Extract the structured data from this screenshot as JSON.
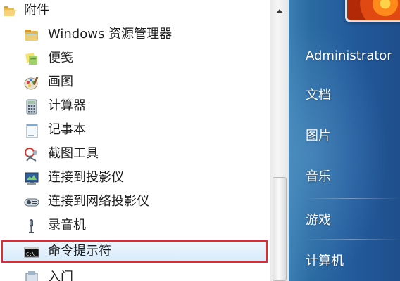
{
  "programs": {
    "folder_label": "附件",
    "items": [
      {
        "label": "Windows 资源管理器",
        "icon": "explorer-folder-icon"
      },
      {
        "label": "便笺",
        "icon": "sticky-notes-icon"
      },
      {
        "label": "画图",
        "icon": "paint-palette-icon"
      },
      {
        "label": "计算器",
        "icon": "calculator-icon"
      },
      {
        "label": "记事本",
        "icon": "notepad-icon"
      },
      {
        "label": "截图工具",
        "icon": "snipping-tool-icon"
      },
      {
        "label": "连接到投影仪",
        "icon": "projector-icon"
      },
      {
        "label": "连接到网络投影仪",
        "icon": "network-projector-icon"
      },
      {
        "label": "录音机",
        "icon": "microphone-icon"
      },
      {
        "label": "命令提示符",
        "icon": "command-prompt-icon"
      },
      {
        "label": "入门",
        "icon": "getting-started-icon"
      }
    ],
    "selected_index": 9
  },
  "right_menu": {
    "items": [
      {
        "label": "Administrator"
      },
      {
        "label": "文档"
      },
      {
        "label": "图片"
      },
      {
        "label": "音乐"
      },
      {
        "label": "游戏"
      },
      {
        "label": "计算机"
      }
    ]
  },
  "colors": {
    "highlight_border": "#e02b35",
    "right_pane": "#22599a"
  }
}
